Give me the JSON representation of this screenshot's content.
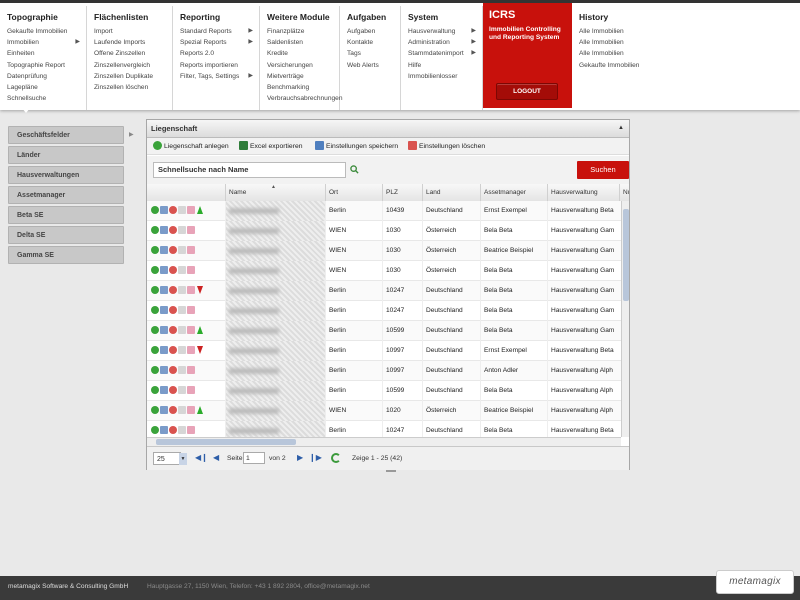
{
  "menu": {
    "columns": [
      {
        "title": "Topographie",
        "items": [
          {
            "label": "Gekaufte Immobilien"
          },
          {
            "label": "Immobilien",
            "sub": true
          },
          {
            "label": "Einheiten"
          },
          {
            "label": "Topographie Report"
          },
          {
            "label": "Datenprüfung"
          },
          {
            "label": "Lagepläne"
          },
          {
            "label": "Schnellsuche"
          }
        ]
      },
      {
        "title": "Flächenlisten",
        "items": [
          {
            "label": "Import"
          },
          {
            "label": "Laufende Imports"
          },
          {
            "label": "Offene Zinszellen"
          },
          {
            "label": "Zinszellenvergleich"
          },
          {
            "label": "Zinszellen Duplikate"
          },
          {
            "label": "Zinszellen löschen"
          }
        ]
      },
      {
        "title": "Reporting",
        "items": [
          {
            "label": "Standard Reports",
            "sub": true
          },
          {
            "label": "Spezial Reports",
            "sub": true
          },
          {
            "label": "Reports 2.0"
          },
          {
            "label": "Reports importieren"
          },
          {
            "label": "Filter, Tags, Settings",
            "sub": true
          }
        ]
      },
      {
        "title": "Weitere Module",
        "items": [
          {
            "label": "Finanzplätze"
          },
          {
            "label": "Saldenlisten"
          },
          {
            "label": "Kredite"
          },
          {
            "label": "Versicherungen"
          },
          {
            "label": "Mietverträge"
          },
          {
            "label": "Benchmarking"
          },
          {
            "label": "Verbrauchsabrechnungen"
          }
        ]
      },
      {
        "title": "Aufgaben",
        "items": [
          {
            "label": "Aufgaben"
          },
          {
            "label": "Kontakte"
          },
          {
            "label": "Tags"
          },
          {
            "label": "Web Alerts"
          }
        ]
      },
      {
        "title": "System",
        "items": [
          {
            "label": "Hausverwaltung",
            "sub": true
          },
          {
            "label": "Administration",
            "sub": true
          },
          {
            "label": "Stammdatenimport",
            "sub": true
          },
          {
            "label": "Hilfe"
          },
          {
            "label": "Immobilienlosser"
          }
        ]
      }
    ],
    "icrs": {
      "title": "ICRS",
      "desc": "Immobilien Controlling und Reporting System",
      "logout": "LOGOUT"
    },
    "history": {
      "title": "History",
      "items": [
        {
          "label": "Alle Immobilien"
        },
        {
          "label": "Alle Immobilien"
        },
        {
          "label": "Alle Immobilien"
        },
        {
          "label": "Gekaufte Immobilien"
        }
      ]
    }
  },
  "leftnav": [
    {
      "label": "Geschäftsfelder"
    },
    {
      "label": "Länder"
    },
    {
      "label": "Hausverwaltungen"
    },
    {
      "label": "Assetmanager"
    },
    {
      "label": "Beta SE"
    },
    {
      "label": "Delta SE"
    },
    {
      "label": "Gamma SE"
    }
  ],
  "panel": {
    "title": "Liegenschaft",
    "toolbar": {
      "new_label": "Liegenschaft anlegen",
      "excel_label": "Excel exportieren",
      "save_settings_label": "Einstellungen speichern",
      "delete_settings_label": "Einstellungen löschen"
    },
    "search": {
      "placeholder": "Schnellsuche nach Name",
      "button": "Suchen"
    },
    "columns": [
      "Name",
      "Ort",
      "PLZ",
      "Land",
      "Assetmanager",
      "Hausverwaltung",
      "Nu"
    ],
    "rows": [
      {
        "ort": "Berlin",
        "plz": "10439",
        "land": "Deutschland",
        "am": "Ernst Exempel",
        "hv": "Hausverwaltung Beta",
        "trend": "up"
      },
      {
        "ort": "WIEN",
        "plz": "1030",
        "land": "Österreich",
        "am": "Bela Beta",
        "hv": "Hausverwaltung Gam",
        "trend": ""
      },
      {
        "ort": "WIEN",
        "plz": "1030",
        "land": "Österreich",
        "am": "Beatrice Beispiel",
        "hv": "Hausverwaltung Gam",
        "trend": ""
      },
      {
        "ort": "WIEN",
        "plz": "1030",
        "land": "Österreich",
        "am": "Bela Beta",
        "hv": "Hausverwaltung Gam",
        "trend": ""
      },
      {
        "ort": "Berlin",
        "plz": "10247",
        "land": "Deutschland",
        "am": "Bela Beta",
        "hv": "Hausverwaltung Gam",
        "trend": "down"
      },
      {
        "ort": "Berlin",
        "plz": "10247",
        "land": "Deutschland",
        "am": "Bela Beta",
        "hv": "Hausverwaltung Gam",
        "trend": ""
      },
      {
        "ort": "Berlin",
        "plz": "10599",
        "land": "Deutschland",
        "am": "Bela Beta",
        "hv": "Hausverwaltung Gam",
        "trend": "up"
      },
      {
        "ort": "Berlin",
        "plz": "10997",
        "land": "Deutschland",
        "am": "Ernst Exempel",
        "hv": "Hausverwaltung Beta",
        "trend": "down"
      },
      {
        "ort": "Berlin",
        "plz": "10997",
        "land": "Deutschland",
        "am": "Anton Adler",
        "hv": "Hausverwaltung Alph",
        "trend": ""
      },
      {
        "ort": "Berlin",
        "plz": "10599",
        "land": "Deutschland",
        "am": "Bela Beta",
        "hv": "Hausverwaltung Alph",
        "trend": ""
      },
      {
        "ort": "WIEN",
        "plz": "1020",
        "land": "Österreich",
        "am": "Beatrice Beispiel",
        "hv": "Hausverwaltung Alph",
        "trend": "up"
      },
      {
        "ort": "Berlin",
        "plz": "10247",
        "land": "Deutschland",
        "am": "Bela Beta",
        "hv": "Hausverwaltung Beta",
        "trend": ""
      }
    ],
    "pager": {
      "page_size": "25",
      "page_label": "Seite",
      "page_value": "1",
      "of_label": "von 2",
      "info": "Zeige 1 - 25 (42)"
    }
  },
  "footer": {
    "company": "metamagix Software & Consulting GmbH",
    "address": "Hauptgasse 27, 1150 Wien, Telefon: +43 1 892 2804, office@metamagix.net",
    "logo": "metamagix"
  },
  "colors": {
    "accent": "#c8110c",
    "selection": "#b8c6da"
  }
}
